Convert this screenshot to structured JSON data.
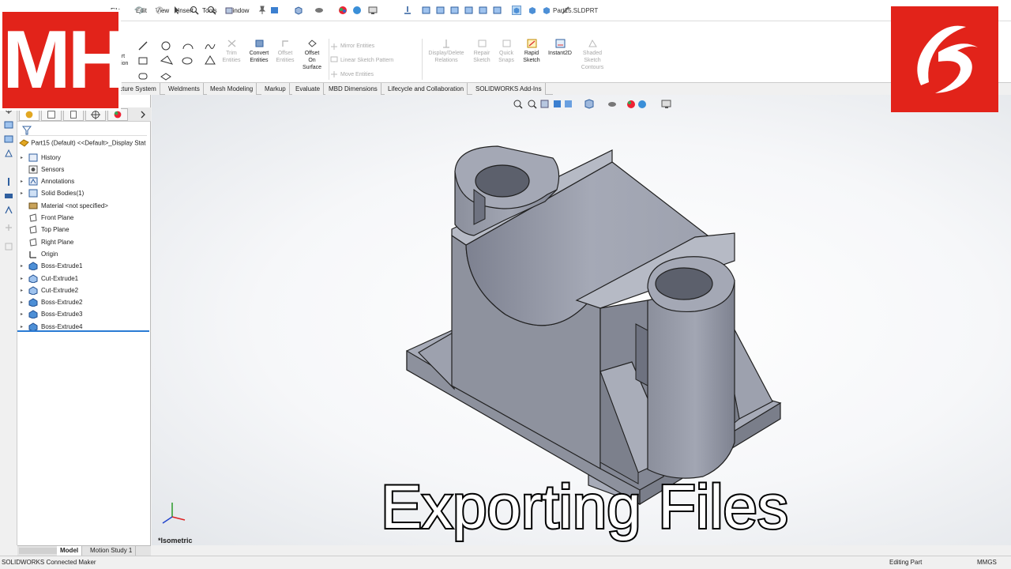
{
  "window": {
    "title": "Part15.SLDPRT"
  },
  "menu": {
    "items": [
      "File",
      "Edit",
      "View",
      "Insert",
      "Tools",
      "Window"
    ]
  },
  "commands": {
    "insert_part_tail": "art",
    "extrude_tail": "sion",
    "trim": [
      "Trim",
      "Entities"
    ],
    "convert": [
      "Convert",
      "Entities"
    ],
    "offset": [
      "Offset",
      "Entities"
    ],
    "offset_surface": [
      "Offset",
      "On",
      "Surface"
    ],
    "mirror": "Mirror Entities",
    "linear_pattern": "Linear Sketch Pattern",
    "move": "Move Entities",
    "relations": [
      "Display/Delete",
      "Relations"
    ],
    "repair": [
      "Repair",
      "Sketch"
    ],
    "quick_snaps": [
      "Quick",
      "Snaps"
    ],
    "rapid_sketch": [
      "Rapid",
      "Sketch"
    ],
    "instant2d": "Instant2D",
    "shaded_contours": [
      "Shaded",
      "Sketch",
      "Contours"
    ]
  },
  "tabs": [
    "Fe",
    "ructure System",
    "Weldments",
    "Mesh Modeling",
    "Markup",
    "Evaluate",
    "MBD Dimensions",
    "Lifecycle and Collaboration",
    "SOLIDWORKS Add-Ins"
  ],
  "feature_tree": {
    "root": "Part15 (Default) <<Default>_Display Stat",
    "items": [
      {
        "label": "History",
        "expandable": true,
        "icon": "history-icon"
      },
      {
        "label": "Sensors",
        "expandable": false,
        "icon": "sensor-icon"
      },
      {
        "label": "Annotations",
        "expandable": true,
        "icon": "annotation-icon"
      },
      {
        "label": "Solid Bodies(1)",
        "expandable": true,
        "icon": "solid-bodies-icon"
      },
      {
        "label": "Material <not specified>",
        "expandable": false,
        "icon": "material-icon"
      },
      {
        "label": "Front Plane",
        "expandable": false,
        "icon": "plane-icon"
      },
      {
        "label": "Top Plane",
        "expandable": false,
        "icon": "plane-icon"
      },
      {
        "label": "Right Plane",
        "expandable": false,
        "icon": "plane-icon"
      },
      {
        "label": "Origin",
        "expandable": false,
        "icon": "origin-icon"
      },
      {
        "label": "Boss-Extrude1",
        "expandable": true,
        "icon": "extrude-icon"
      },
      {
        "label": "Cut-Extrude1",
        "expandable": true,
        "icon": "cut-extrude-icon"
      },
      {
        "label": "Cut-Extrude2",
        "expandable": true,
        "icon": "cut-extrude-icon"
      },
      {
        "label": "Boss-Extrude2",
        "expandable": true,
        "icon": "extrude-icon"
      },
      {
        "label": "Boss-Extrude3",
        "expandable": true,
        "icon": "extrude-icon"
      },
      {
        "label": "Boss-Extrude4",
        "expandable": true,
        "icon": "extrude-icon"
      }
    ]
  },
  "viewport": {
    "view_name": "*Isometric"
  },
  "bottom_tabs": {
    "model": "Model",
    "motion": "Motion Study 1"
  },
  "status": {
    "left": "SOLIDWORKS Connected Maker",
    "mode": "Editing Part",
    "units": "MMGS"
  },
  "overlay": {
    "logo_text": "MH",
    "caption": "Exporting Files"
  },
  "colors": {
    "accent_red": "#e2231a",
    "model_body": "#8e929e",
    "selection_blue": "#2a7bd4"
  }
}
